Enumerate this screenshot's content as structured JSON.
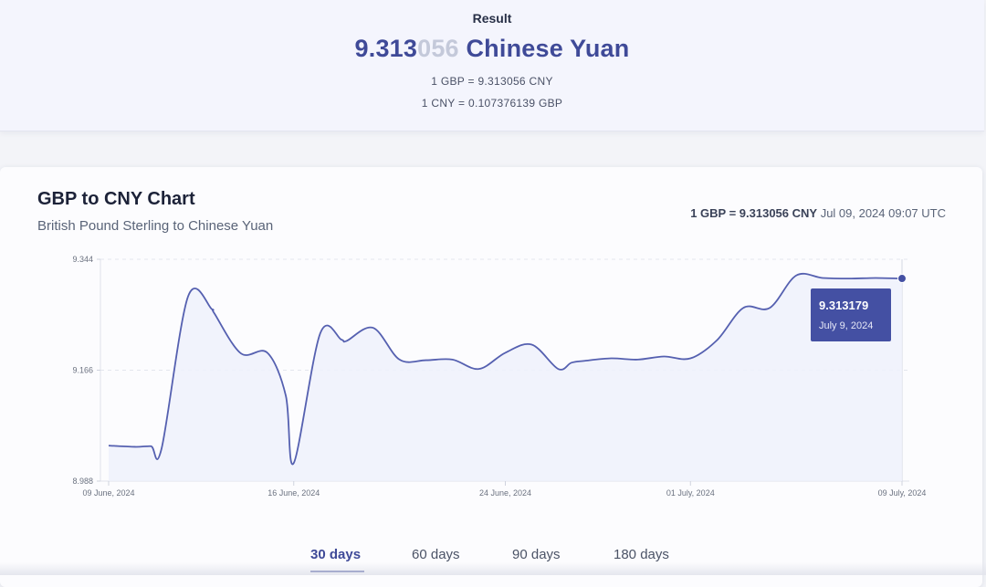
{
  "result": {
    "heading": "Result",
    "amount_main": "9.313",
    "amount_faded": "056",
    "currency_name": "Chinese Yuan",
    "rate_line_1": "1 GBP = 9.313056 CNY",
    "rate_line_2": "1 CNY = 0.107376139 GBP"
  },
  "chart_card": {
    "title": "GBP to CNY Chart",
    "subtitle": "British Pound Sterling to Chinese Yuan",
    "rate_bold": "1 GBP = 9.313056 CNY",
    "rate_time": "Jul 09, 2024 09:07 UTC"
  },
  "tooltip": {
    "value": "9.313179",
    "date": "July 9, 2024"
  },
  "tabs": [
    "30 days",
    "60 days",
    "90 days",
    "180 days"
  ],
  "active_tab": 0,
  "colors": {
    "line": "#5560b0",
    "accent": "#3f4a98",
    "tooltip": "#4450a3"
  },
  "chart_data": {
    "type": "area",
    "title": "GBP to CNY Chart",
    "subtitle": "British Pound Sterling to Chinese Yuan",
    "xlabel": "",
    "ylabel": "",
    "ylim": [
      8.988,
      9.344
    ],
    "yticks": [
      "9.344",
      "9.166",
      "8.988"
    ],
    "xticks": [
      "09 June, 2024",
      "16 June, 2024",
      "24 June, 2024",
      "01 July, 2024",
      "09 July, 2024"
    ],
    "xtick_days": [
      0,
      7,
      15,
      22,
      30
    ],
    "grid": "horizontal dashed",
    "series": [
      {
        "days": [
          0,
          1,
          1.6,
          2,
          3,
          3.9,
          4,
          5,
          6,
          6.7,
          7,
          8,
          8.8,
          9,
          10,
          11,
          12,
          13,
          14,
          15,
          16,
          17,
          17.5,
          18,
          19,
          20,
          21,
          22,
          23,
          24,
          25,
          26,
          27,
          28,
          29,
          30
        ],
        "values": [
          9.045,
          9.043,
          9.044,
          9.04,
          9.284,
          9.264,
          9.257,
          9.193,
          9.194,
          9.125,
          9.017,
          9.225,
          9.215,
          9.213,
          9.234,
          9.183,
          9.182,
          9.183,
          9.168,
          9.194,
          9.207,
          9.168,
          9.178,
          9.181,
          9.185,
          9.183,
          9.188,
          9.185,
          9.214,
          9.266,
          9.266,
          9.318,
          9.314,
          9.313,
          9.314,
          9.313
        ]
      }
    ],
    "highlight": {
      "day": 30,
      "value": 9.313179,
      "label": "9.313179",
      "date": "July 9, 2024"
    }
  }
}
